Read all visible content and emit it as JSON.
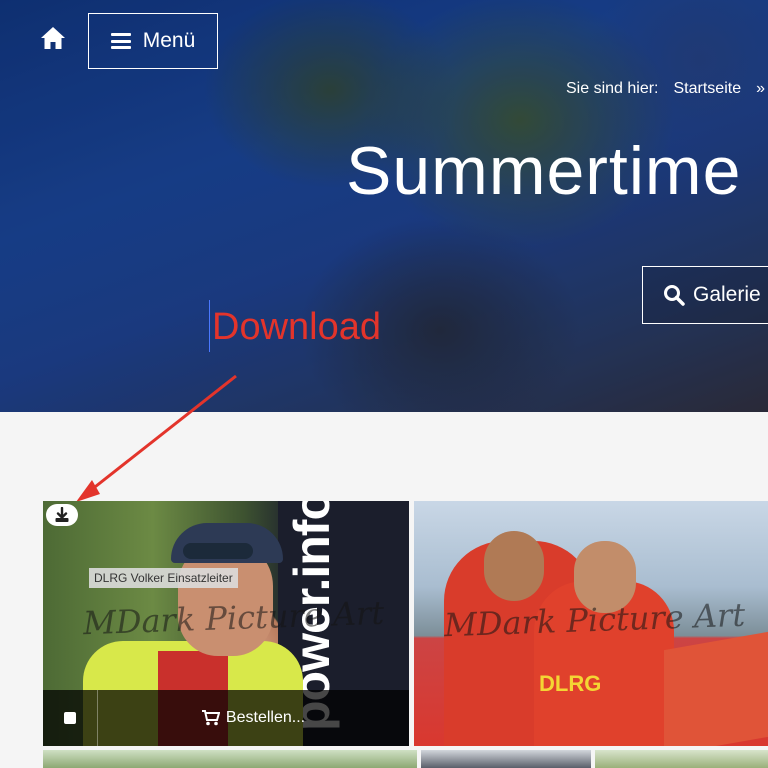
{
  "header": {
    "menu_label": "Menü",
    "breadcrumb_label": "Sie sind hier:",
    "breadcrumb_home": "Startseite",
    "breadcrumb_sep": "»"
  },
  "hero": {
    "title": "Summertime",
    "gallery_button": "Galerie"
  },
  "annotation": {
    "text": "Download",
    "color": "#e3342b"
  },
  "gallery": {
    "tiles": [
      {
        "tag": "DLRG Volker Einsatzleiter",
        "watermark": "MDark Picture Art",
        "banner_text": "power.info",
        "order_label": "Bestellen..."
      },
      {
        "watermark": "MDark Picture Art",
        "shirt_text": "DLRG"
      }
    ]
  },
  "icons": {
    "home": "home-icon",
    "menu": "hamburger-icon",
    "search": "search-icon",
    "download": "download-icon",
    "cart": "cart-icon"
  }
}
